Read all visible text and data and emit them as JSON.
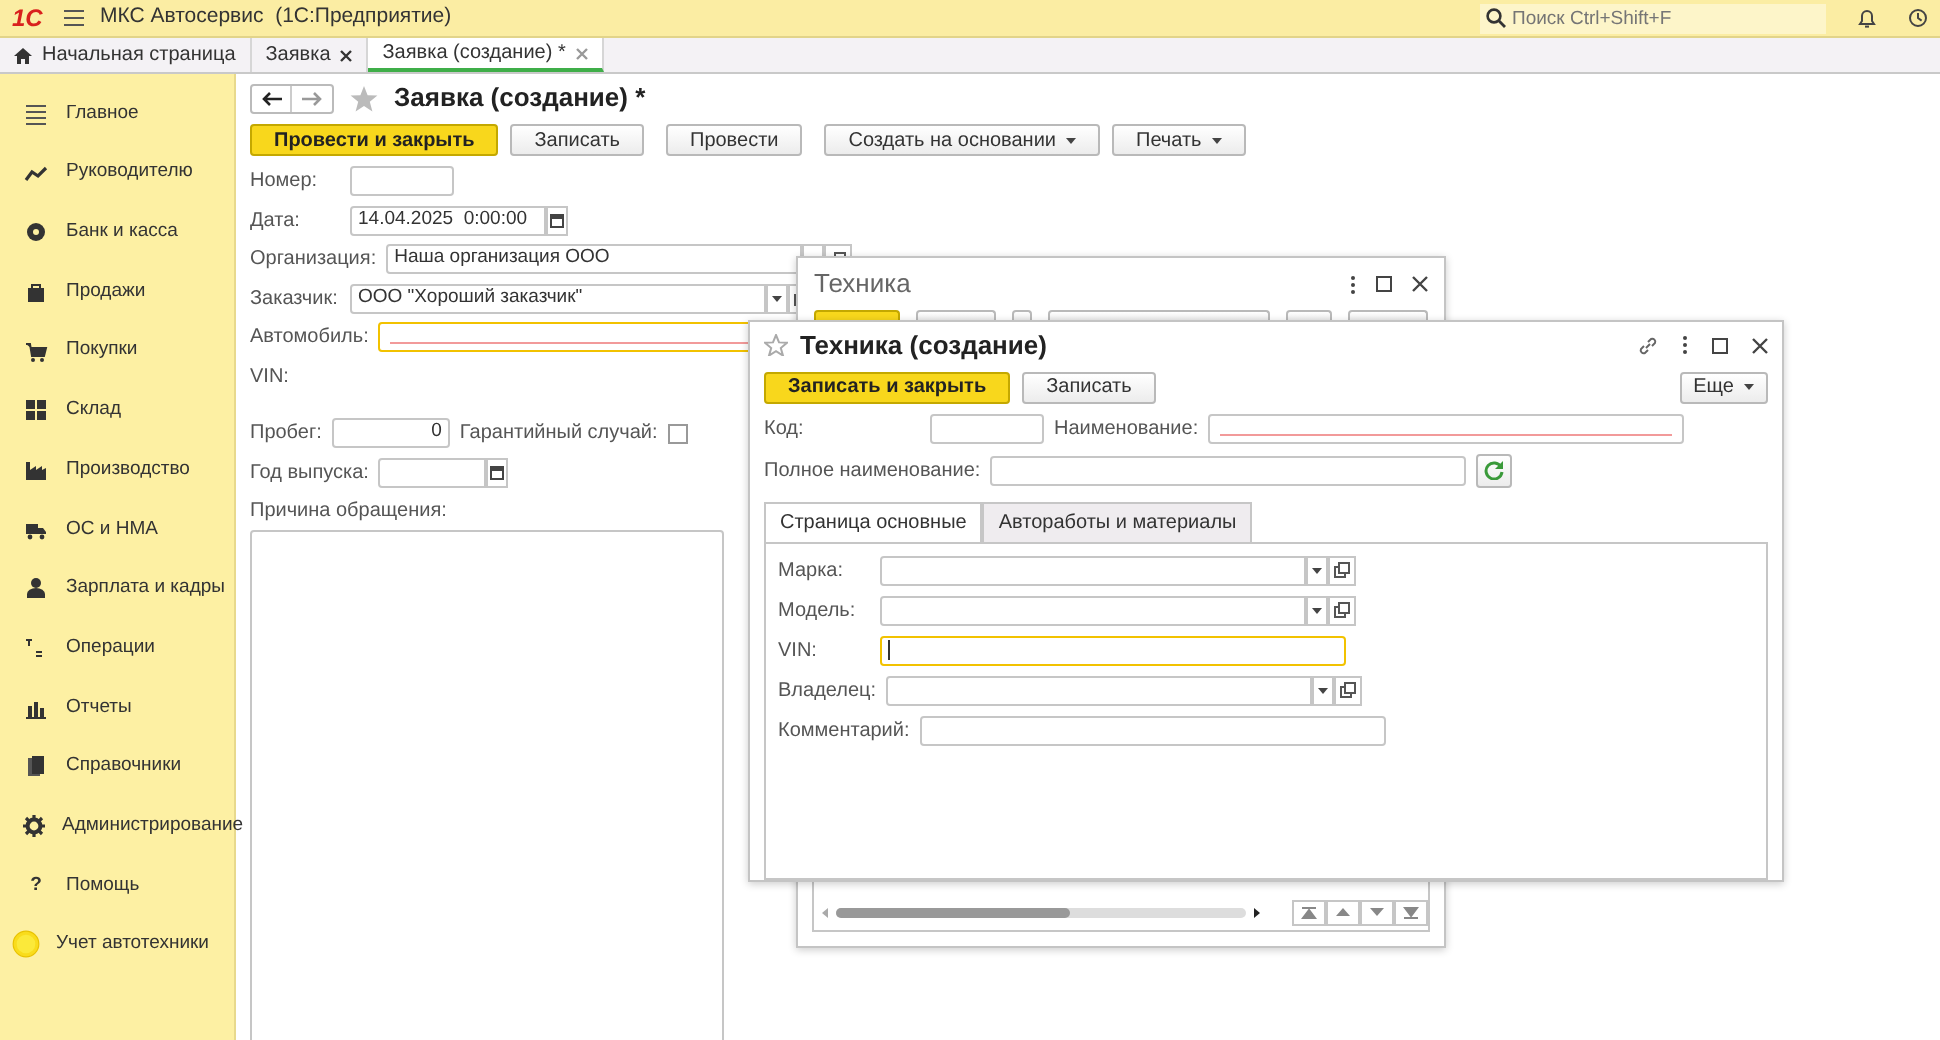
{
  "topbar": {
    "logo": "1С",
    "title": "МКС Автосервис  (1С:Предприятие)",
    "search_placeholder": "Поиск Ctrl+Shift+F"
  },
  "tabs": [
    {
      "label": "Начальная страница",
      "kind": "home",
      "selected": false
    },
    {
      "label": "Заявка",
      "kind": "document",
      "selected": false
    },
    {
      "label": "Заявка (создание) *",
      "kind": "document",
      "selected": true
    }
  ],
  "sidebar": {
    "items": [
      {
        "label": "Главное"
      },
      {
        "label": "Руководителю"
      },
      {
        "label": "Банк и касса"
      },
      {
        "label": "Продажи"
      },
      {
        "label": "Покупки"
      },
      {
        "label": "Склад"
      },
      {
        "label": "Производство"
      },
      {
        "label": "ОС и НМА"
      },
      {
        "label": "Зарплата и кадры"
      },
      {
        "label": "Операции"
      },
      {
        "label": "Отчеты"
      },
      {
        "label": "Справочники"
      },
      {
        "label": "Администрирование"
      },
      {
        "label": "Помощь",
        "glyph": "?"
      },
      {
        "label": "Учет автотехники"
      }
    ]
  },
  "form": {
    "title": "Заявка (создание) *",
    "buttons": [
      {
        "label": "Провести и закрыть",
        "kind": "primary"
      },
      {
        "label": "Записать",
        "kind": "plain"
      },
      {
        "label": "Провести",
        "kind": "plain"
      },
      {
        "label": "Создать на основании",
        "kind": "menu"
      },
      {
        "label": "Печать",
        "kind": "menu"
      }
    ],
    "rows": [
      [
        {
          "kind": "text",
          "label": "Номер:"
        }
      ],
      [
        {
          "kind": "date",
          "label": "Дата:",
          "value": "14.04.2025  0:00:00"
        }
      ],
      [
        {
          "kind": "select",
          "label": "Организация:",
          "value": "Наша организация ООО"
        }
      ],
      [
        {
          "kind": "select",
          "label": "Заказчик:",
          "value": "ООО \"Хороший заказчик\""
        }
      ],
      [
        {
          "kind": "text",
          "label": "Автомобиль:",
          "required": true,
          "focused": true
        }
      ],
      [
        {
          "kind": "caption",
          "label": "VIN:"
        }
      ],
      [
        {
          "kind": "number",
          "label": "Пробег:",
          "value": "0"
        },
        {
          "kind": "checkbox",
          "label": "Гарантийный случай:",
          "checked": false
        }
      ],
      [
        {
          "kind": "date",
          "label": "Год выпуска:"
        }
      ],
      [
        {
          "kind": "textarea",
          "label": "Причина обращения:"
        }
      ]
    ]
  },
  "back_window": {
    "title": "Техника"
  },
  "dialog": {
    "title": "Техника (создание)",
    "buttons": [
      {
        "label": "Записать и закрыть",
        "kind": "primary"
      },
      {
        "label": "Записать",
        "kind": "plain"
      }
    ],
    "more_button": {
      "label": "Еще"
    },
    "rows": [
      [
        {
          "kind": "text",
          "label": "Код:"
        },
        {
          "kind": "text",
          "label": "Наименование:",
          "required": true
        }
      ],
      [
        {
          "kind": "text",
          "label": "Полное наименование:"
        },
        {
          "kind": "refresh"
        }
      ]
    ],
    "tabs": [
      {
        "label": "Страница основные",
        "selected": true
      },
      {
        "label": "Автоработы и материалы",
        "selected": false
      }
    ],
    "tab_rows": [
      [
        {
          "kind": "select",
          "label": "Марка:"
        }
      ],
      [
        {
          "kind": "select",
          "label": "Модель:"
        }
      ],
      [
        {
          "kind": "text",
          "label": "VIN:",
          "focused": true
        }
      ],
      [
        {
          "kind": "select",
          "label": "Владелец:"
        }
      ],
      [
        {
          "kind": "text",
          "label": "Комментарий:"
        }
      ]
    ]
  }
}
